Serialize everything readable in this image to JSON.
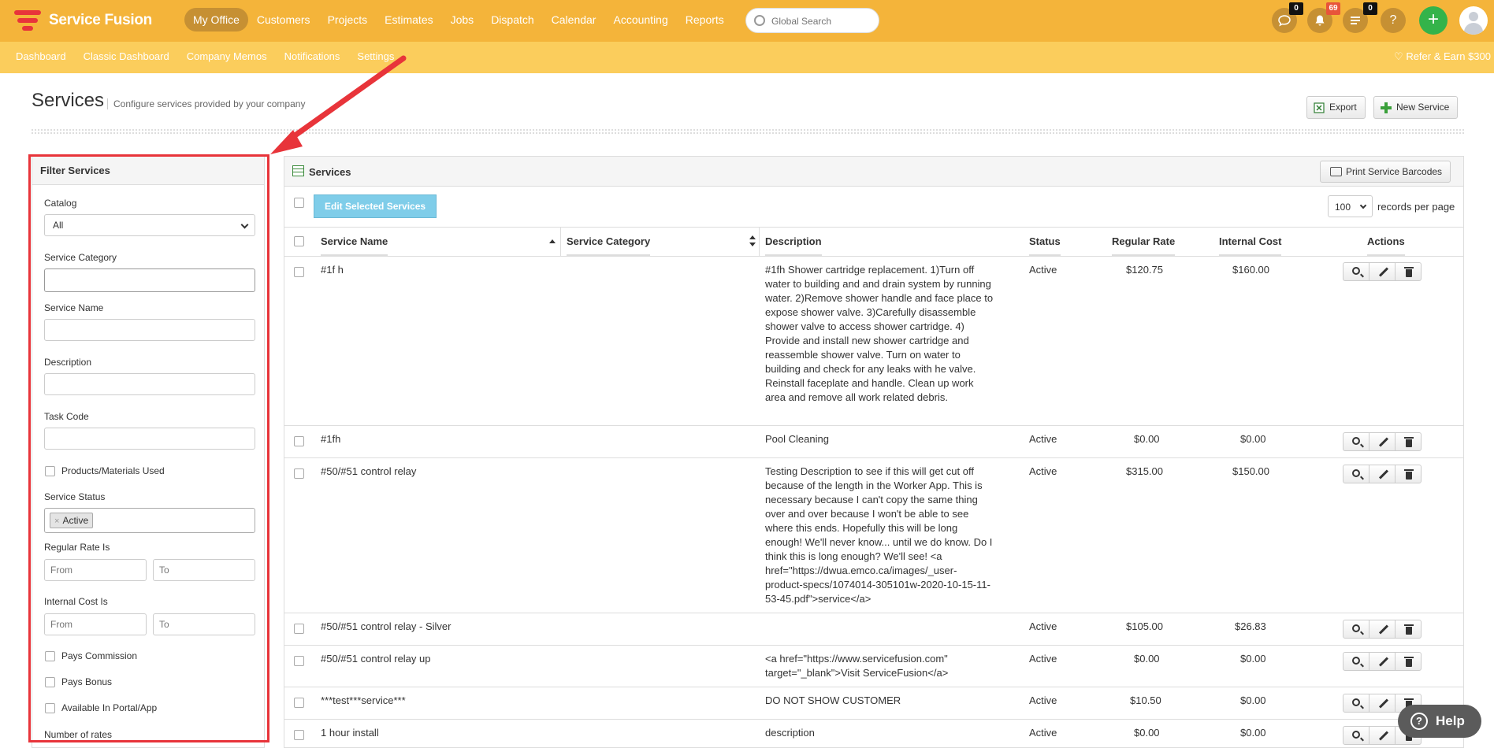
{
  "app": {
    "logo_text": "Service Fusion"
  },
  "topnav": {
    "items": [
      "My Office",
      "Customers",
      "Projects",
      "Estimates",
      "Jobs",
      "Dispatch",
      "Calendar",
      "Accounting",
      "Reports"
    ],
    "active": "My Office",
    "search_placeholder": "Global Search",
    "chat_count": "0",
    "notif_count": "69",
    "tasks_count": "0",
    "help_glyph": "?",
    "plus_glyph": "+"
  },
  "subnav": {
    "items": [
      "Dashboard",
      "Classic Dashboard",
      "Company Memos",
      "Notifications",
      "Settings"
    ],
    "refer": "Refer & Earn $300"
  },
  "page": {
    "title": "Services",
    "subtitle": "Configure services provided by your company",
    "export_label": "Export",
    "new_service_label": "New Service"
  },
  "filter": {
    "title": "Filter Services",
    "catalog_label": "Catalog",
    "catalog_value": "All",
    "category_label": "Service Category",
    "name_label": "Service Name",
    "description_label": "Description",
    "task_code_label": "Task Code",
    "products_used_label": "Products/Materials Used",
    "status_label": "Service Status",
    "status_tag": "Active",
    "status_tag_remove": "×",
    "regular_rate_label": "Regular Rate Is",
    "internal_cost_label": "Internal Cost Is",
    "from_placeholder": "From",
    "to_placeholder": "To",
    "pays_commission_label": "Pays Commission",
    "pays_bonus_label": "Pays Bonus",
    "available_portal_label": "Available In Portal/App",
    "number_of_rates_label": "Number of rates"
  },
  "services": {
    "title": "Services",
    "print_barcodes_label": "Print Service Barcodes",
    "edit_selected_label": "Edit Selected Services",
    "records_per_page_value": "100",
    "records_per_page_label": "records per page",
    "columns": {
      "name": "Service Name",
      "category": "Service Category",
      "description": "Description",
      "status": "Status",
      "regular_rate": "Regular Rate",
      "internal_cost": "Internal Cost",
      "actions": "Actions"
    },
    "rows": [
      {
        "name": "#1f h",
        "category": "",
        "description": "#1fh Shower cartridge replacement. 1)Turn off water to building and and drain system by running water. 2)Remove shower handle and face place to expose shower valve. 3)Carefully disassemble shower valve to access shower cartridge. 4) Provide and install new shower cartridge and reassemble shower valve. Turn on water to building and check for any leaks with he valve. Reinstall faceplate and handle. Clean up work area and remove all work related debris.",
        "status": "Active",
        "regular_rate": "$120.75",
        "internal_cost": "$160.00"
      },
      {
        "name": "#1fh",
        "category": "",
        "description": "Pool Cleaning",
        "status": "Active",
        "regular_rate": "$0.00",
        "internal_cost": "$0.00"
      },
      {
        "name": "#50/#51 control relay",
        "category": "",
        "description": "Testing Description to see if this will get cut off because of the length in the Worker App. This is necessary because I can't copy the same thing over and over because I won't be able to see where this ends. Hopefully this will be long enough! We'll never know... until we do know. Do I think this is long enough? We'll see! <a href=\"https://dwua.emco.ca/images/_user-product-specs/1074014-305101w-2020-10-15-11-53-45.pdf\">service</a>",
        "status": "Active",
        "regular_rate": "$315.00",
        "internal_cost": "$150.00"
      },
      {
        "name": "#50/#51 control relay - Silver",
        "category": "",
        "description": "",
        "status": "Active",
        "regular_rate": "$105.00",
        "internal_cost": "$26.83"
      },
      {
        "name": "#50/#51 control relay up",
        "category": "",
        "description": "<a href=\"https://www.servicefusion.com\" target=\"_blank\">Visit ServiceFusion</a>",
        "status": "Active",
        "regular_rate": "$0.00",
        "internal_cost": "$0.00"
      },
      {
        "name": "***test***service***",
        "category": "",
        "description": "DO NOT SHOW CUSTOMER",
        "status": "Active",
        "regular_rate": "$10.50",
        "internal_cost": "$0.00"
      },
      {
        "name": "1 hour install",
        "category": "",
        "description": "description",
        "status": "Active",
        "regular_rate": "$0.00",
        "internal_cost": "$0.00"
      }
    ]
  },
  "help": {
    "label": "Help",
    "glyph": "?"
  },
  "colors": {
    "topbar": "#f4b43a",
    "subbar": "#fbcd5c",
    "highlight": "#e8343a",
    "edit_button": "#7fcde9",
    "add_button": "#34b34a"
  }
}
